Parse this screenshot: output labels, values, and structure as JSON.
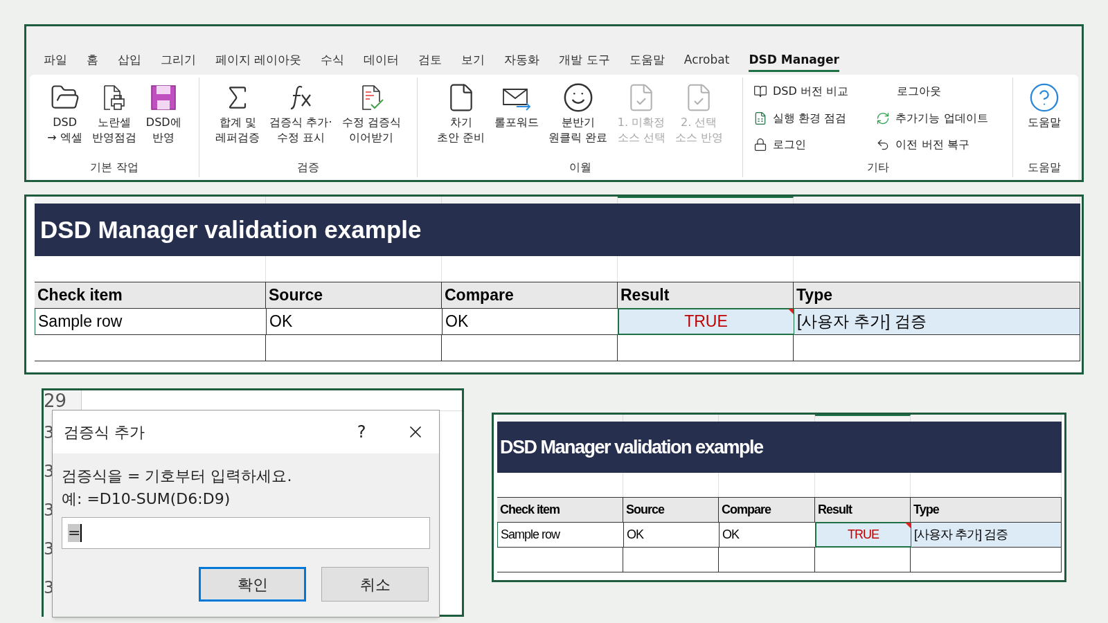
{
  "ribbon": {
    "tabs": [
      {
        "label": "파일",
        "selected": false
      },
      {
        "label": "홈",
        "selected": false
      },
      {
        "label": "삽입",
        "selected": false
      },
      {
        "label": "그리기",
        "selected": false
      },
      {
        "label": "페이지 레이아웃",
        "selected": false
      },
      {
        "label": "수식",
        "selected": false
      },
      {
        "label": "데이터",
        "selected": false
      },
      {
        "label": "검토",
        "selected": false
      },
      {
        "label": "보기",
        "selected": false
      },
      {
        "label": "자동화",
        "selected": false
      },
      {
        "label": "개발 도구",
        "selected": false
      },
      {
        "label": "도움말",
        "selected": false
      },
      {
        "label": "Acrobat",
        "selected": false
      },
      {
        "label": "DSD Manager",
        "selected": true
      }
    ],
    "groups": [
      {
        "label": "기본 작업",
        "items": [
          {
            "kind": "large",
            "lines": [
              "DSD",
              "→ 엑셀"
            ],
            "disabled": false
          },
          {
            "kind": "large",
            "lines": [
              "노란셀",
              "반영점검"
            ],
            "disabled": false
          },
          {
            "kind": "large",
            "lines": [
              "DSD에",
              "반영"
            ],
            "disabled": false
          }
        ]
      },
      {
        "label": "검증",
        "items": [
          {
            "kind": "large",
            "lines": [
              "합계 및",
              "레퍼검증"
            ],
            "disabled": false
          },
          {
            "kind": "large",
            "lines": [
              "검증식 추가·",
              "수정 표시"
            ],
            "disabled": false
          },
          {
            "kind": "large",
            "lines": [
              "수정 검증식",
              "이어받기"
            ],
            "disabled": false
          }
        ]
      },
      {
        "label": "이월",
        "items": [
          {
            "kind": "large",
            "lines": [
              "차기",
              "초안 준비"
            ],
            "disabled": false
          },
          {
            "kind": "large",
            "lines": [
              "롤포워드"
            ],
            "disabled": false
          },
          {
            "kind": "large",
            "lines": [
              "분반기",
              "원클릭 완료"
            ],
            "disabled": false
          },
          {
            "kind": "large",
            "lines": [
              "1. 미확정",
              "소스 선택"
            ],
            "disabled": true
          },
          {
            "kind": "large",
            "lines": [
              "2. 선택",
              "소스 반영"
            ],
            "disabled": true
          }
        ]
      },
      {
        "label": "기타",
        "items": [
          {
            "kind": "small",
            "lines": [
              "DSD 버전 비교"
            ],
            "disabled": false
          },
          {
            "kind": "small",
            "lines": [
              "실행 환경 점검"
            ],
            "disabled": false
          },
          {
            "kind": "small",
            "lines": [
              "로그인"
            ],
            "disabled": false
          },
          {
            "kind": "text",
            "lines": [
              "로그아웃"
            ],
            "disabled": false
          },
          {
            "kind": "small",
            "lines": [
              "추가기능 업데이트"
            ],
            "disabled": false
          },
          {
            "kind": "small",
            "lines": [
              "이전 버전 복구"
            ],
            "disabled": false
          }
        ]
      },
      {
        "label": "도움말",
        "items": [
          {
            "kind": "large",
            "lines": [
              "도움말"
            ],
            "disabled": false
          }
        ]
      }
    ]
  },
  "sheet": {
    "title": "DSD Manager validation example",
    "columns": [
      "Check item",
      "Source",
      "Compare",
      "Result",
      "Type"
    ],
    "row": [
      {
        "text": "Sample row",
        "kind": "text",
        "selected": false,
        "shaded": false,
        "comment": false
      },
      {
        "text": "OK",
        "kind": "text",
        "selected": false,
        "shaded": false,
        "comment": false
      },
      {
        "text": "OK",
        "kind": "text",
        "selected": false,
        "shaded": false,
        "comment": false
      },
      {
        "text": "TRUE",
        "kind": "bool",
        "selected": true,
        "shaded": true,
        "comment": true
      },
      {
        "text": "[사용자 추가] 검증",
        "kind": "text",
        "selected": false,
        "shaded": true,
        "comment": false
      }
    ]
  },
  "dialog": {
    "row_numbers": [
      "29",
      "3",
      "3",
      "3",
      "3",
      "3"
    ],
    "title": "검증식 추가",
    "help": "?",
    "message": [
      "검증식을 = 기호부터 입력하세요.",
      "예: =D10-SUM(D6:D9)"
    ],
    "input_value": "=",
    "buttons": [
      {
        "label": "확인",
        "default": true
      },
      {
        "label": "취소",
        "default": false
      }
    ]
  },
  "sheet_small": {
    "title": "DSD Manager validation example",
    "columns": [
      "Check item",
      "Source",
      "Compare",
      "Result",
      "Type"
    ],
    "row": [
      {
        "text": "Sample row",
        "kind": "text",
        "selected": false,
        "shaded": false,
        "comment": false
      },
      {
        "text": "OK",
        "kind": "text",
        "selected": false,
        "shaded": false,
        "comment": false
      },
      {
        "text": "OK",
        "kind": "text",
        "selected": false,
        "shaded": false,
        "comment": false
      },
      {
        "text": "TRUE",
        "kind": "bool",
        "selected": true,
        "shaded": true,
        "comment": true
      },
      {
        "text": "[사용자 추가] 검증",
        "kind": "text",
        "selected": false,
        "shaded": true,
        "comment": false
      }
    ]
  }
}
